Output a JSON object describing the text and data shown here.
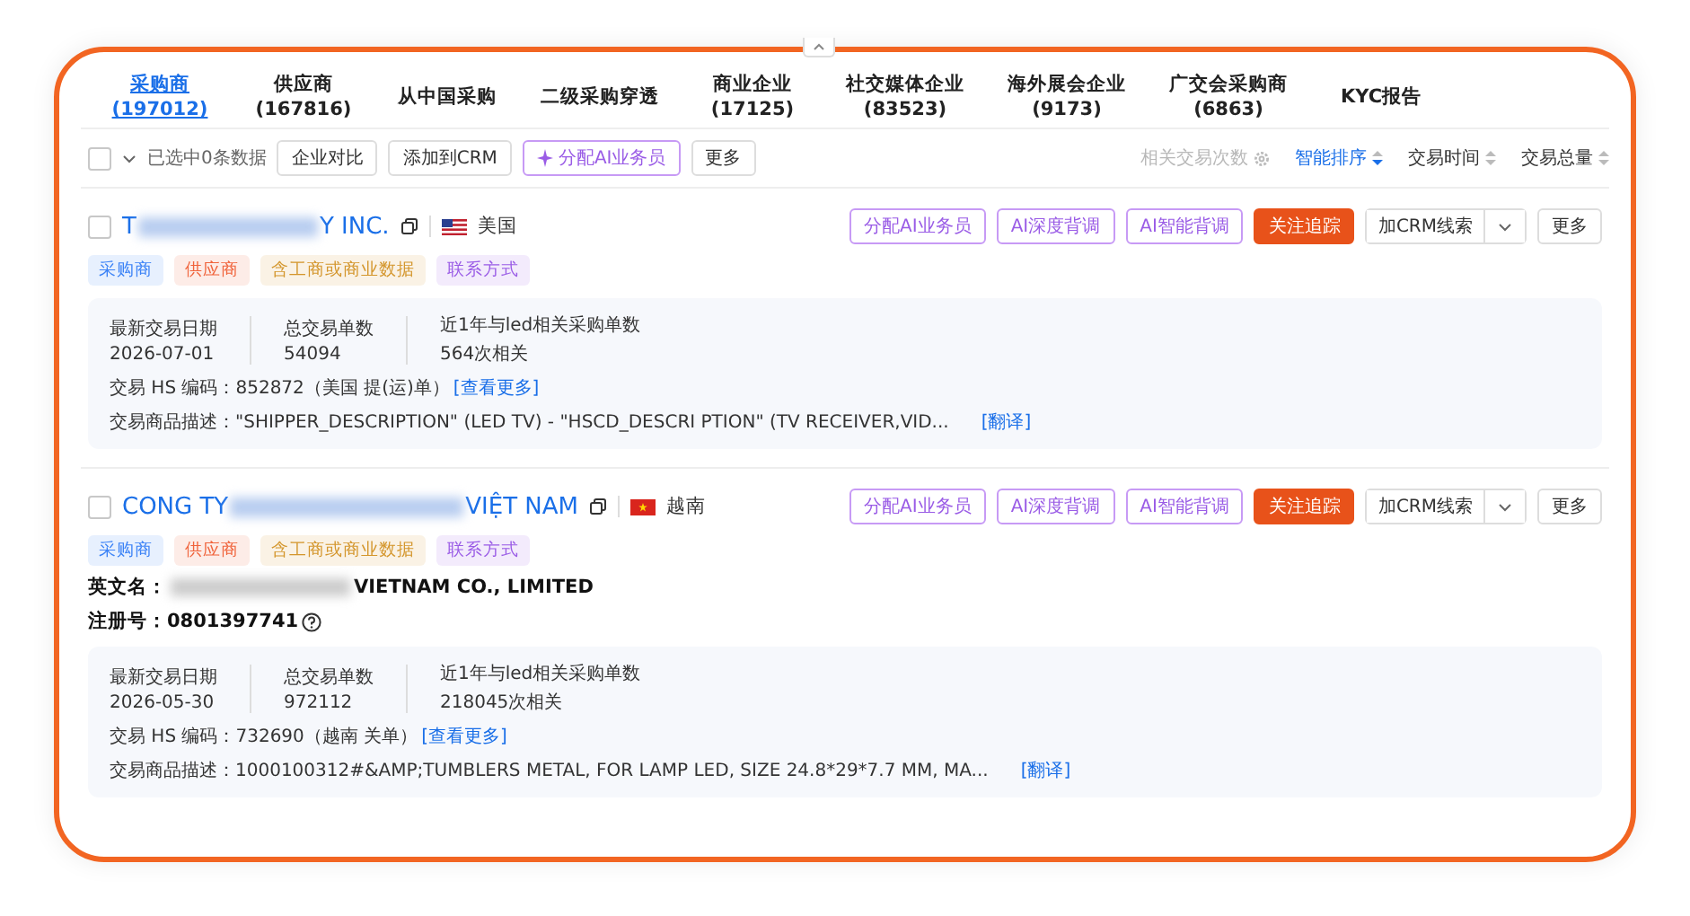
{
  "tabs": [
    {
      "label": "采购商",
      "count": "(197012)",
      "selected": true
    },
    {
      "label": "供应商",
      "count": "(167816)",
      "selected": false
    },
    {
      "label": "从中国采购",
      "selected": false
    },
    {
      "label": "二级采购穿透",
      "selected": false
    },
    {
      "label": "商业企业",
      "count": "(17125)",
      "selected": false
    },
    {
      "label": "社交媒体企业",
      "count": "(83523)",
      "selected": false
    },
    {
      "label": "海外展会企业",
      "count": "(9173)",
      "selected": false
    },
    {
      "label": "广交会采购商",
      "count": "(6863)",
      "selected": false
    },
    {
      "label": "KYC报告",
      "selected": false
    }
  ],
  "toolbar": {
    "select_all_checked": false,
    "selection_text": "已选中0条数据",
    "buttons": [
      {
        "label": "企业对比",
        "kind": "default"
      },
      {
        "label": "添加到CRM",
        "kind": "default"
      },
      {
        "label": "分配AI业务员",
        "kind": "ai"
      },
      {
        "label": "更多",
        "kind": "default"
      }
    ],
    "sorts": [
      {
        "label": "相关交易次数",
        "kind": "setting",
        "selected": false,
        "disabled": true
      },
      {
        "label": "智能排序",
        "kind": "sort",
        "selected": true,
        "disabled": false
      },
      {
        "label": "交易时间",
        "kind": "sort",
        "selected": false,
        "disabled": false
      },
      {
        "label": "交易总量",
        "kind": "sort",
        "selected": false,
        "disabled": false
      }
    ]
  },
  "results": [
    {
      "checked": false,
      "name_start": "T",
      "name_end": "Y INC.",
      "flag": {
        "kind": "us"
      },
      "country": "美国",
      "actions": [
        {
          "label": "分配AI业务员",
          "kind": "ai"
        },
        {
          "label": "AI深度背调",
          "kind": "ai"
        },
        {
          "label": "AI智能背调",
          "kind": "ai"
        },
        {
          "label": "关注追踪",
          "kind": "primary"
        },
        {
          "label": "加CRM线索",
          "kind": "split"
        },
        {
          "label": "更多",
          "kind": "default"
        }
      ],
      "tags": [
        {
          "label": "采购商",
          "color": "#3b82f6"
        },
        {
          "label": "供应商",
          "color": "#f0643c"
        },
        {
          "label": "含工商或商业数据",
          "color": "#d4962c"
        },
        {
          "label": "联系方式",
          "color": "#9a5ce6"
        }
      ],
      "stats": [
        {
          "label": "最新交易日期",
          "value": "2026-07-01"
        },
        {
          "label": "总交易单数",
          "value": "54094"
        },
        {
          "label": "近1年与led相关采购单数",
          "value": "564次相关"
        }
      ],
      "hs_label": "交易 HS 编码：",
      "hs_value": "852872（美国 提(运)单）",
      "hs_link": "[查看更多]",
      "desc_label": "交易商品描述：",
      "desc_value": "\"SHIPPER_DESCRIPTION\" (LED TV) - \"HSCD_DESCRI PTION\" (TV RECEIVER,VID...",
      "desc_link": "[翻译]"
    },
    {
      "checked": false,
      "name_start": "CONG TY",
      "name_end": "VIỆT NAM",
      "flag": {
        "kind": "vn"
      },
      "country": "越南",
      "actions": [
        {
          "label": "分配AI业务员",
          "kind": "ai"
        },
        {
          "label": "AI深度背调",
          "kind": "ai"
        },
        {
          "label": "AI智能背调",
          "kind": "ai"
        },
        {
          "label": "关注追踪",
          "kind": "primary"
        },
        {
          "label": "加CRM线索",
          "kind": "split"
        },
        {
          "label": "更多",
          "kind": "default"
        }
      ],
      "tags": [
        {
          "label": "采购商",
          "color": "#3b82f6"
        },
        {
          "label": "供应商",
          "color": "#f0643c"
        },
        {
          "label": "含工商或商业数据",
          "color": "#d4962c"
        },
        {
          "label": "联系方式",
          "color": "#9a5ce6"
        }
      ],
      "english_label": "英文名：",
      "english_name_end": "VIETNAM CO., LIMITED",
      "reg_label": "注册号：",
      "reg_value": "0801397741",
      "stats": [
        {
          "label": "最新交易日期",
          "value": "2026-05-30"
        },
        {
          "label": "总交易单数",
          "value": "972112"
        },
        {
          "label": "近1年与led相关采购单数",
          "value": "218045次相关"
        }
      ],
      "hs_label": "交易 HS 编码：",
      "hs_value": "732690（越南 关单）",
      "hs_link": "[查看更多]",
      "desc_label": "交易商品描述：",
      "desc_value": "1000100312#&AMP;TUMBLERS METAL, FOR LAMP LED, SIZE 24.8*29*7.7 MM, MA...",
      "desc_link": "[翻译]"
    }
  ]
}
